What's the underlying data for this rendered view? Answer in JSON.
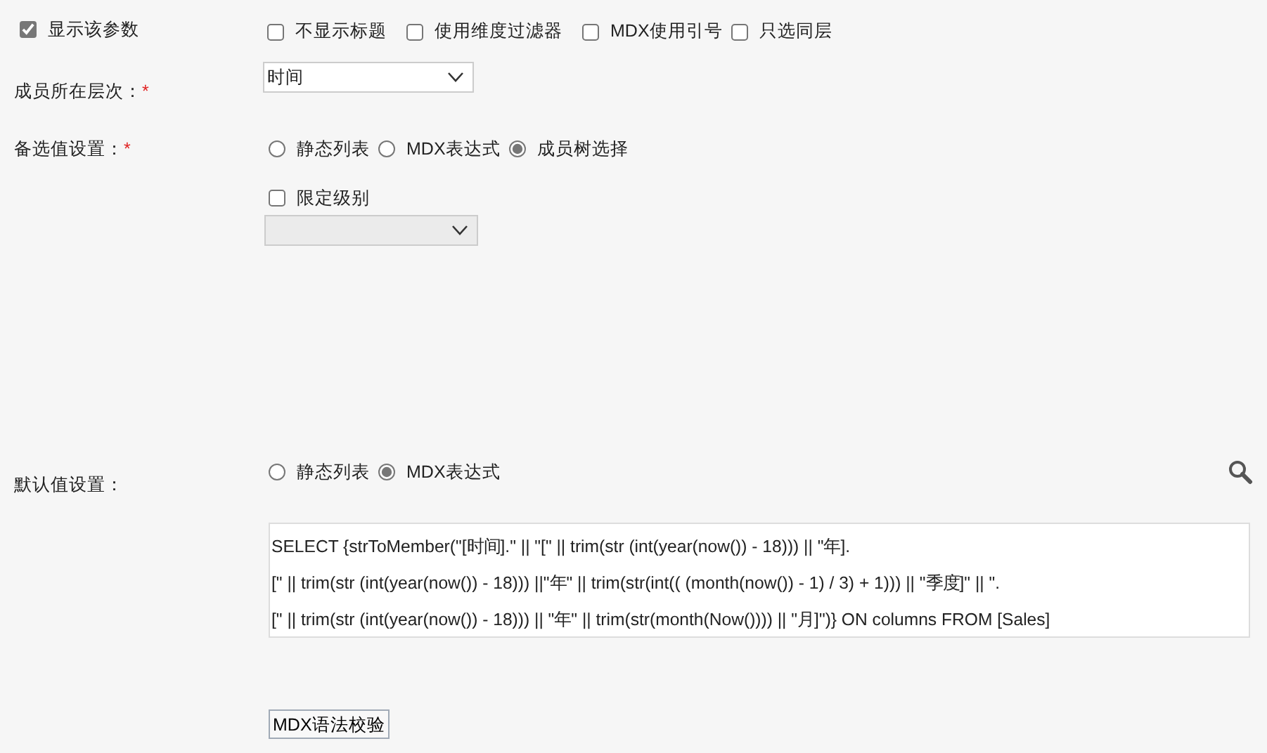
{
  "show_param": {
    "label": "显示该参数",
    "checked": true
  },
  "options": [
    {
      "label": "不显示标题",
      "checked": false
    },
    {
      "label": "使用维度过滤器",
      "checked": false
    },
    {
      "label": "MDX使用引号",
      "checked": false
    },
    {
      "label": "只选同层",
      "checked": false
    }
  ],
  "level_field": {
    "label": "成员所在层次：",
    "required_mark": "*",
    "value": "时间"
  },
  "candidate": {
    "label": "备选值设置：",
    "required_mark": "*",
    "radios": [
      {
        "label": "静态列表",
        "selected": false
      },
      {
        "label": "MDX表达式",
        "selected": false
      },
      {
        "label": "成员树选择",
        "selected": true
      }
    ],
    "limit_level": {
      "label": "限定级别",
      "checked": false
    },
    "level_select": {
      "disabled": true
    }
  },
  "default": {
    "label": "默认值设置：",
    "radios": [
      {
        "label": "静态列表",
        "selected": false
      },
      {
        "label": "MDX表达式",
        "selected": true
      }
    ],
    "expression_lines": [
      "SELECT {strToMember(\"[时间].\" || \"[\" || trim(str (int(year(now()) - 18))) || \"年].",
      "[\" || trim(str (int(year(now()) - 18))) ||\"年\" || trim(str(int(( (month(now()) - 1) / 3) + 1))) || \"季度]\" || \".",
      "[\" || trim(str (int(year(now()) - 18))) || \"年\" || trim(str(month(Now()))) || \"月]\")} ON columns FROM [Sales]"
    ]
  },
  "validate_button": "MDX语法校验"
}
